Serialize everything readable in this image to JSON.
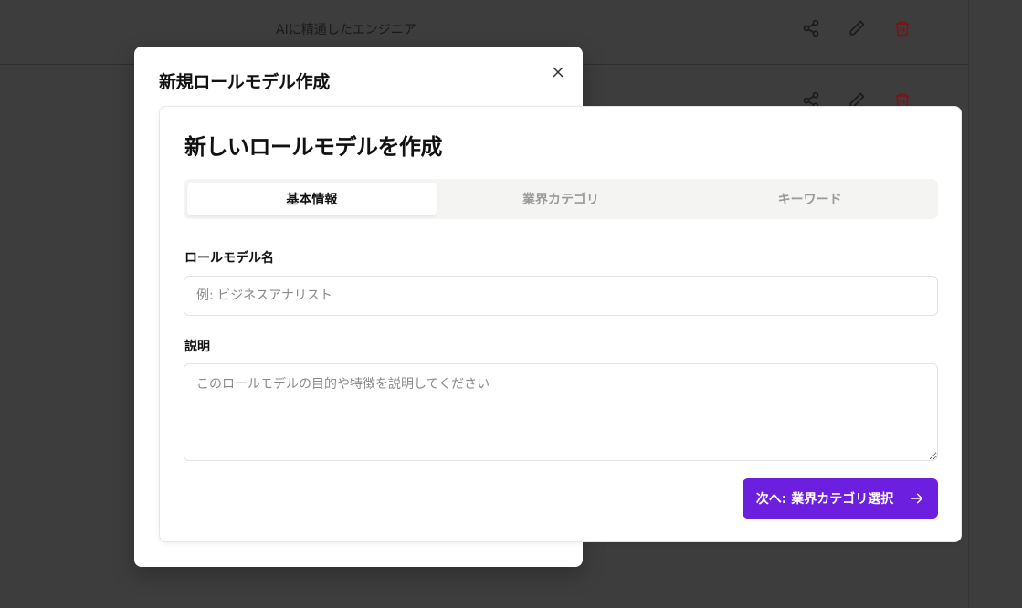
{
  "background_list": {
    "rows": [
      {
        "title": "AIに精通したエンジニア"
      },
      {
        "title": ""
      }
    ],
    "icons": [
      "share-icon",
      "pencil-icon",
      "trash-icon"
    ],
    "trash_color": "#a11818"
  },
  "outer_dialog": {
    "title": "新規ロールモデル作成",
    "close_icon": "close-icon"
  },
  "form": {
    "title": "新しいロールモデルを作成",
    "tabs": [
      {
        "label": "基本情報",
        "active": true
      },
      {
        "label": "業界カテゴリ",
        "active": false
      },
      {
        "label": "キーワード",
        "active": false
      }
    ],
    "name_field": {
      "label": "ロールモデル名",
      "placeholder": "例: ビジネスアナリスト",
      "value": ""
    },
    "description_field": {
      "label": "説明",
      "placeholder": "このロールモデルの目的や特徴を説明してください",
      "value": ""
    },
    "next_button": {
      "label": "次へ: 業界カテゴリ選択",
      "icon": "arrow-right-icon"
    }
  },
  "colors": {
    "accent": "#6d1fe0",
    "backdrop": "#3d3d3d"
  }
}
